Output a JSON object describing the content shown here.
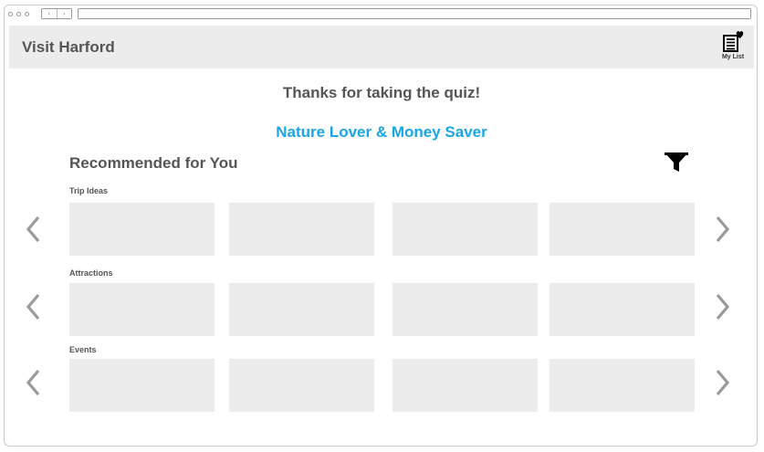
{
  "browser": {
    "nav_back": "‹",
    "nav_forward": "›"
  },
  "header": {
    "title": "Visit Harford",
    "my_list_label": "My List",
    "my_list_icon": "list-heart-icon"
  },
  "quiz": {
    "thanks_text": "Thanks for taking the quiz!",
    "persona": "Nature Lover & Money Saver",
    "persona_color": "#1aa5e8"
  },
  "recommendations": {
    "heading": "Recommended for You",
    "filter_icon": "filter-funnel-icon",
    "rows": [
      {
        "label": "Trip Ideas"
      },
      {
        "label": "Attractions"
      },
      {
        "label": "Events"
      }
    ]
  },
  "colors": {
    "placeholder": "#ececec",
    "text": "#555555",
    "accent": "#1aa5e8",
    "arrow": "#9a9a9a"
  }
}
